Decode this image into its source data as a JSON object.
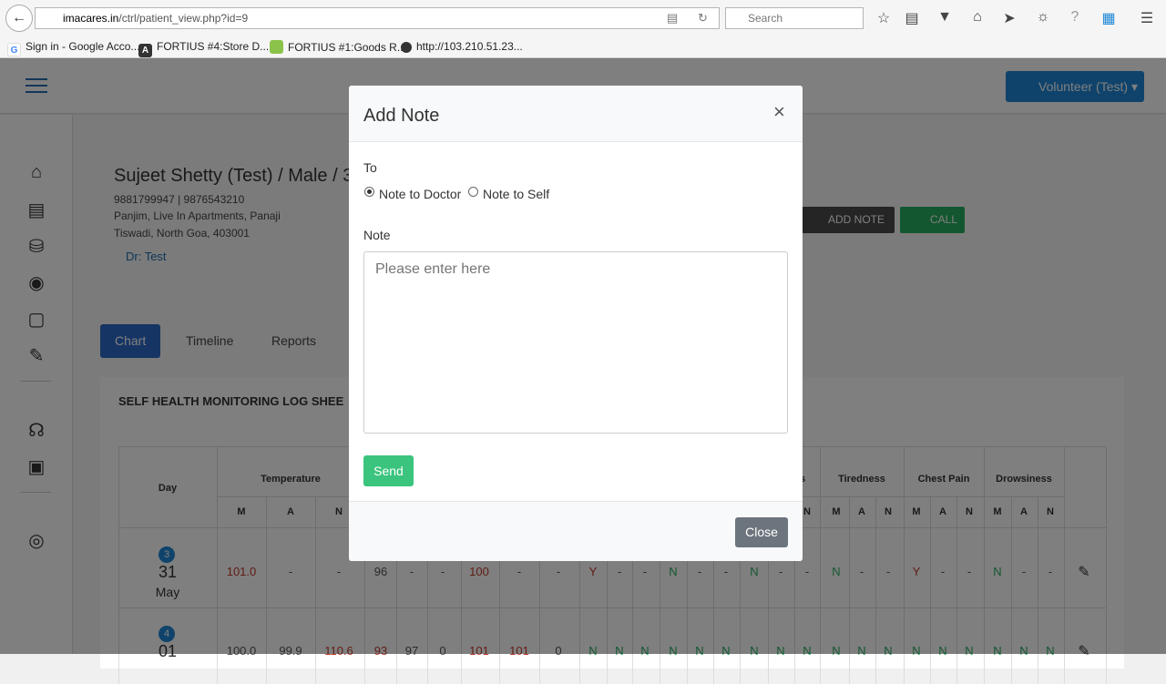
{
  "browser": {
    "url_host": "imacares.in",
    "url_path": "/ctrl/patient_view.php?id=9",
    "search_placeholder": "Search",
    "bookmarks": [
      "Sign in - Google Acco...",
      "FORTIUS #4:Store D...",
      "FORTIUS #1:Goods R...",
      "http://103.210.51.23..."
    ]
  },
  "topbar": {
    "user_label": "Volunteer (Test)"
  },
  "patient": {
    "name": "Sujeet Shetty (Test) / Male / 3",
    "phones": "9881799947 | 9876543210",
    "address_line1": "Panjim, Live In Apartments, Panaji",
    "address_line2": "Tiswadi, North Goa, 403001",
    "doctor": "Dr: Test"
  },
  "actions": {
    "add_note": "ADD NOTE",
    "call": "CALL"
  },
  "tabs": [
    {
      "label": "Chart",
      "active": true
    },
    {
      "label": "Timeline",
      "active": false
    },
    {
      "label": "Reports",
      "active": false
    }
  ],
  "card": {
    "title": "SELF HEALTH MONITORING LOG SHEE",
    "headers": {
      "day": "Day",
      "temperature": "Temperature",
      "tiredness": "Tiredness",
      "chest_pain": "Chest Pain",
      "drowsiness": "Drowsiness",
      "s_partial": "s"
    },
    "mnan": [
      "M",
      "A",
      "N"
    ],
    "rows": [
      {
        "badge": "3",
        "date": "31",
        "month": "May",
        "temp": [
          "101.0",
          "-",
          "-"
        ],
        "mid": [
          "96",
          "-",
          "-",
          "100",
          "-",
          "-",
          "Y",
          "-",
          "-",
          "N",
          "-",
          "-",
          "N",
          "-",
          "-"
        ],
        "tired": [
          "N",
          "-",
          "-"
        ],
        "chest": [
          "Y",
          "-",
          "-"
        ],
        "drowsy": [
          "N",
          "-",
          "-"
        ]
      },
      {
        "badge": "4",
        "date": "01",
        "month": "",
        "temp": [
          "100.0",
          "99.9",
          "110.6"
        ],
        "mid": [
          "93",
          "97",
          "0",
          "101",
          "101",
          "0",
          "N",
          "N",
          "N",
          "N",
          "N",
          "N",
          "N",
          "N",
          "N"
        ],
        "tired": [
          "N",
          "N",
          "N"
        ],
        "chest": [
          "N",
          "N",
          "N"
        ],
        "drowsy": [
          "N",
          "N",
          "N"
        ]
      }
    ]
  },
  "modal": {
    "title": "Add Note",
    "close_x": "×",
    "to_label": "To",
    "options": [
      {
        "label": "Note to Doctor",
        "selected": true
      },
      {
        "label": "Note to Self",
        "selected": false
      }
    ],
    "note_label": "Note",
    "note_placeholder": "Please enter here",
    "send_label": "Send",
    "close_label": "Close"
  }
}
